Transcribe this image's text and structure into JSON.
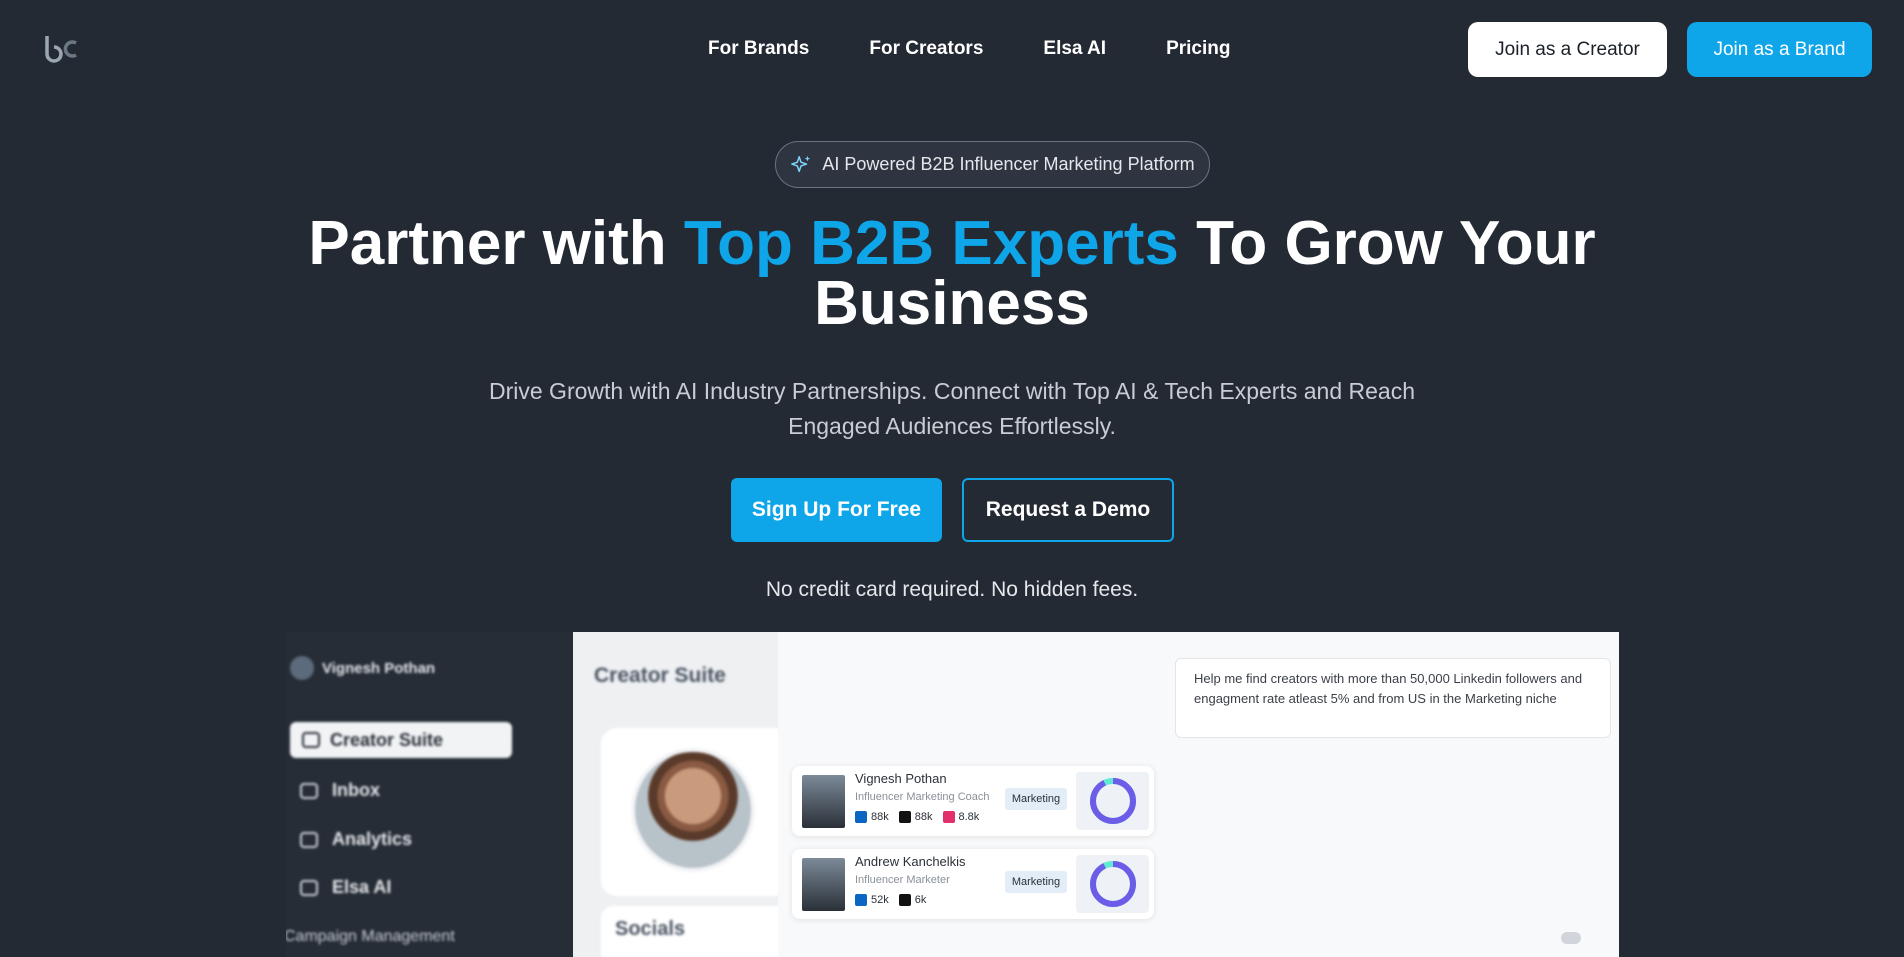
{
  "nav": {
    "logo_text": "bc",
    "links": [
      "For Brands",
      "For Creators",
      "Elsa AI",
      "Pricing"
    ],
    "join_creator": "Join as a Creator",
    "join_brand": "Join as a Brand"
  },
  "hero": {
    "pill": "AI Powered B2B Influencer Marketing Platform",
    "title_part1": "Partner with ",
    "title_accent": "Top B2B Experts",
    "title_part2": " To Grow Your Business",
    "subtitle": "Drive Growth with AI Industry Partnerships. Connect with Top AI & Tech Experts and Reach Engaged Audiences Effortlessly.",
    "signup": "Sign Up For Free",
    "demo": "Request a Demo",
    "note": "No credit card required. No hidden fees."
  },
  "preview": {
    "user_name": "Vignesh Pothan",
    "sidebar": {
      "active": "Creator Suite",
      "items": [
        "Inbox",
        "Analytics",
        "Elsa AI"
      ],
      "partial": "Campaign Management"
    },
    "main_title": "Creator Suite",
    "socials_title": "Socials",
    "prompt": "Help me find creators with more than 50,000 Linkedin followers and engagment rate atleast 5% and from US in the Marketing niche",
    "cards": [
      {
        "name": "Vignesh Pothan",
        "role": "Influencer Marketing Coach",
        "linkedin": "88k",
        "x": "88k",
        "instagram": "8.8k",
        "tag": "Marketing",
        "score": 0.93
      },
      {
        "name": "Andrew Kanchelkis",
        "role": "Influencer Marketer",
        "linkedin": "52k",
        "x": "6k",
        "tag": "Marketing",
        "score": 0.93
      }
    ]
  },
  "colors": {
    "background": "#232a33",
    "accent": "#0ea5e9"
  }
}
